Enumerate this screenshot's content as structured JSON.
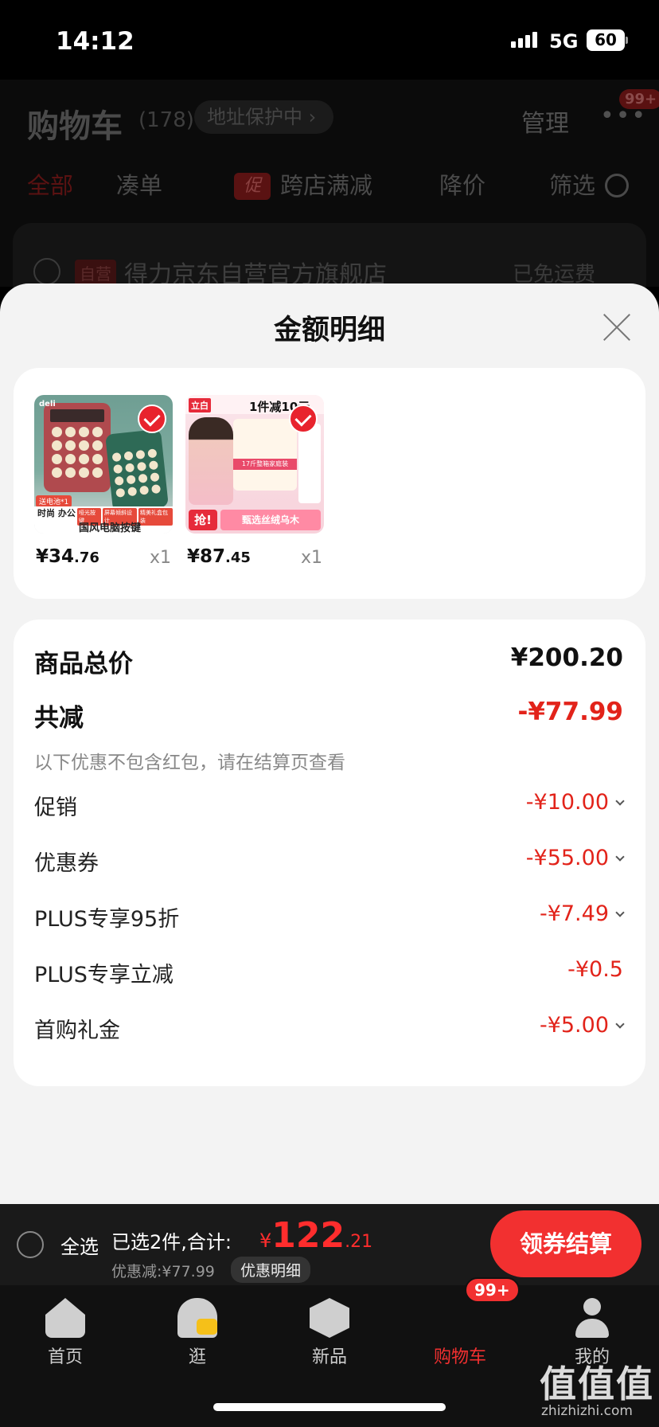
{
  "status_bar": {
    "time": "14:12",
    "network": "5G",
    "battery": "60"
  },
  "cart_header": {
    "title": "购物车",
    "count": "(178)",
    "address_protect": "地址保护中",
    "manage": "管理",
    "more_badge": "99+",
    "tabs": [
      "全部",
      "凑单",
      "跨店满减",
      "降价",
      "筛选"
    ],
    "promo_tag": "促",
    "store": {
      "self_tag": "自营",
      "name": "得力京东自营官方旗舰店",
      "shipping": "已免运费"
    }
  },
  "sheet": {
    "title": "金额明细",
    "products": [
      {
        "price_int": "¥34",
        "price_dec": ".76",
        "qty": "x1",
        "image_text": {
          "logo": "deli",
          "tag": "送电池*1",
          "left": "时尚 办公",
          "badges": [
            "哑光按键",
            "屏幕倾斜设计",
            "精美礼盒包装"
          ],
          "caption": "国风电脑按键"
        }
      },
      {
        "price_int": "¥87",
        "price_dec": ".45",
        "qty": "x1",
        "image_text": {
          "brand": "立白",
          "promo": "1件减10元",
          "pack_band": "17斤整箱家庭装",
          "grab": "抢!",
          "caption": "甄选丝绒乌木"
        }
      }
    ],
    "totals": {
      "goods_total_label": "商品总价",
      "goods_total_value": "¥200.20",
      "reduce_label": "共减",
      "reduce_value": "-¥77.99",
      "note": "以下优惠不包含红包，请在结算页查看",
      "items": [
        {
          "label": "促销",
          "value": "-¥10.00",
          "expand": true
        },
        {
          "label": "优惠券",
          "value": "-¥55.00",
          "expand": true
        },
        {
          "label": "PLUS专享95折",
          "value": "-¥7.49",
          "expand": true
        },
        {
          "label": "PLUS专享立减",
          "value": "-¥0.5",
          "expand": false
        },
        {
          "label": "首购礼金",
          "value": "-¥5.00",
          "expand": true
        }
      ]
    }
  },
  "checkout": {
    "select_all": "全选",
    "selected": "已选2件,合计:",
    "yen": "¥",
    "total_int": "122",
    "total_dec": ".21",
    "discount": "优惠减:¥77.99",
    "detail_button": "优惠明细",
    "checkout_button": "领券结算"
  },
  "tabbar": {
    "items": [
      "首页",
      "逛",
      "新品",
      "购物车",
      "我的"
    ],
    "cart_badge": "99+",
    "active": "购物车"
  },
  "watermark": {
    "main": "值值值",
    "url": "zhizhizhi.com"
  }
}
